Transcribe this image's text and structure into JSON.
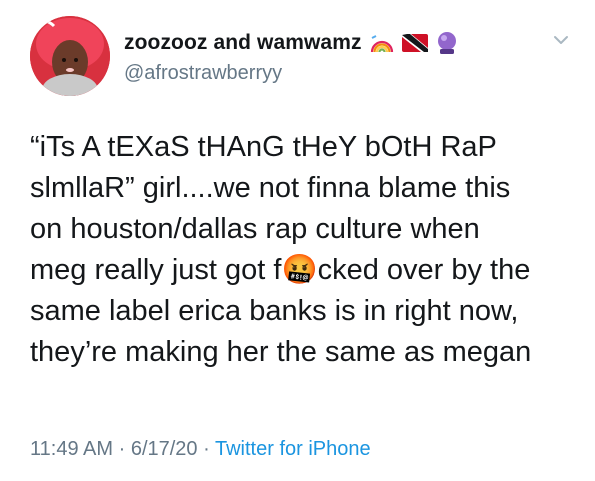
{
  "tweet": {
    "display_name": "zoozooz and wamwamz",
    "badges": [
      {
        "icon": "rainbow-icon",
        "description_color": "#e0245e"
      },
      {
        "icon": "trinidad-flag-icon"
      },
      {
        "icon": "crystal-ball-icon"
      }
    ],
    "handle": "@afrostrawberryy",
    "text_lines": [
      "“iTs A tEXaS tHAnG tHeY bOtH RaP",
      "slmllaR” girl....we not finna blame this",
      "on houston/dallas rap culture when",
      "meg really just got f",
      "cked over by the",
      "same label erica banks is in right now,",
      "they’re making her the same as megan"
    ],
    "censor_glyph": "🤬",
    "time": "11:49 AM",
    "separator": "·",
    "date": "6/17/20",
    "source": "Twitter for iPhone"
  },
  "colors": {
    "text": "#14171a",
    "secondary": "#657786",
    "link": "#1b95e0",
    "avatar_bg": "#e23b4a"
  }
}
